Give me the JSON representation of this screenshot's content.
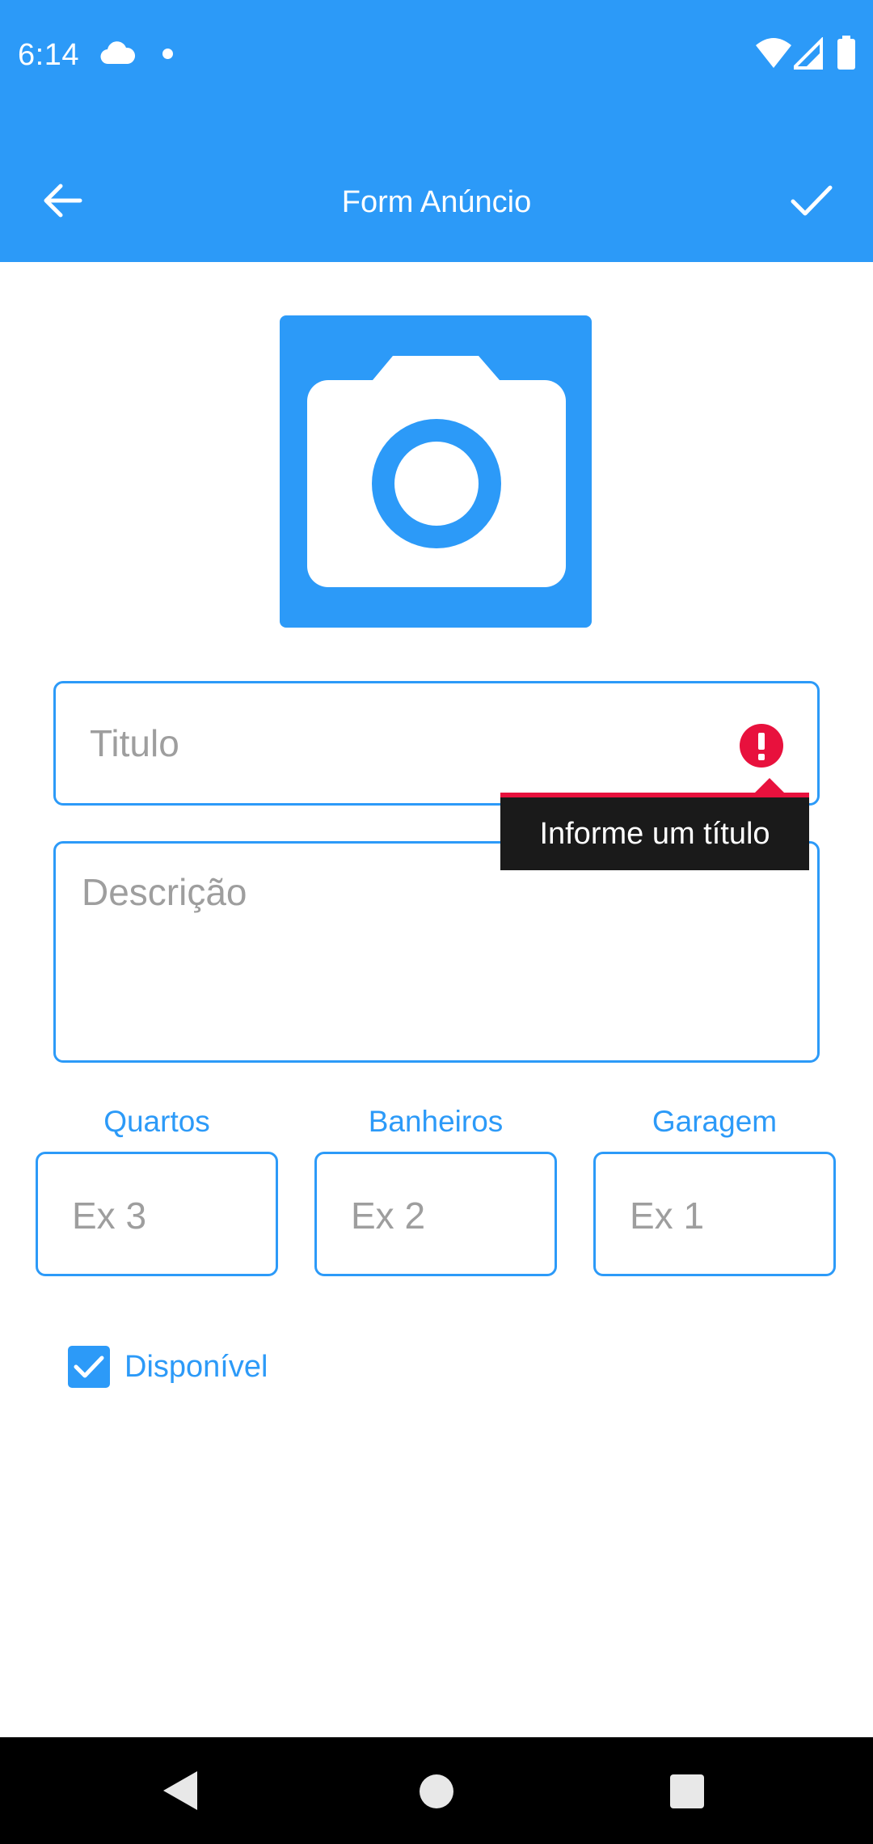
{
  "status_bar": {
    "time": "6:14",
    "icons": [
      "cloud-icon",
      "notification-dot-icon",
      "wifi-icon",
      "signal-icon",
      "battery-icon"
    ]
  },
  "app_bar": {
    "title": "Form Anúncio",
    "back_icon": "arrow-left-icon",
    "confirm_icon": "check-icon",
    "background_color": "#2c9af8"
  },
  "photo": {
    "icon": "camera-icon"
  },
  "form": {
    "title_placeholder": "Titulo",
    "title_error": "Informe um título",
    "description_placeholder": "Descrição",
    "rooms": {
      "label": "Quartos",
      "placeholder": "Ex 3"
    },
    "bathrooms": {
      "label": "Banheiros",
      "placeholder": "Ex 2"
    },
    "garage": {
      "label": "Garagem",
      "placeholder": "Ex 1"
    },
    "available": {
      "label": "Disponível",
      "checked": true
    }
  },
  "colors": {
    "accent": "#2c9af8",
    "error": "#e8113d",
    "placeholder": "#9e9e9e"
  },
  "nav_bar": {
    "icons": [
      "nav-back-icon",
      "nav-home-icon",
      "nav-recents-icon"
    ]
  }
}
